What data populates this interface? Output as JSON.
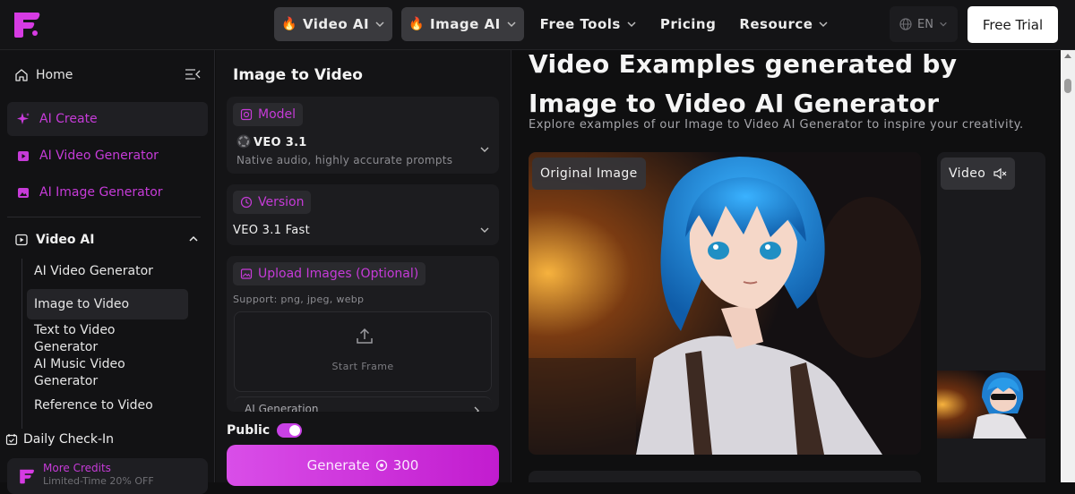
{
  "topbar": {
    "nav": [
      {
        "label": "Video AI",
        "fire": "🔥",
        "highlighted": true
      },
      {
        "label": "Image AI",
        "fire": "🔥",
        "highlighted": true
      },
      {
        "label": "Free Tools"
      },
      {
        "label": "Pricing"
      },
      {
        "label": "Resource"
      }
    ],
    "language": "EN",
    "trial_label": "Free Trial"
  },
  "sidebar": {
    "home": "Home",
    "items": [
      {
        "label": "AI Create",
        "icon": "sparkle-icon"
      },
      {
        "label": "AI Video Generator",
        "icon": "video-icon"
      },
      {
        "label": "AI Image Generator",
        "icon": "image-icon"
      }
    ],
    "group": "Video AI",
    "subitems": [
      "AI Video Generator",
      "Image to Video",
      "Text to Video Generator",
      "AI Music Video Generator",
      "Reference to Video"
    ],
    "checkin": "Daily Check-In",
    "promo": {
      "line1": "More Credits",
      "line2": "Limited-Time 20% OFF"
    }
  },
  "panel": {
    "title": "Image to Video",
    "model": {
      "chip": "Model",
      "value": "VEO 3.1",
      "note": "Native audio, highly accurate prompts"
    },
    "version": {
      "chip": "Version",
      "value": "VEO 3.1 Fast"
    },
    "upload": {
      "chip": "Upload Images (Optional)",
      "support": "Support: png, jpeg, webp",
      "start_frame": "Start Frame",
      "ai_generation": "AI Generation"
    },
    "public_label": "Public",
    "public_on": true,
    "generate_label": "Generate",
    "generate_cost": "300"
  },
  "main": {
    "heading": "Video Examples generated by Image to Video AI Generator",
    "description": "Explore examples of our Image to Video AI Generator to inspire your creativity.",
    "original_label": "Original Image",
    "video_label": "Video"
  },
  "colors": {
    "accent": "#c63bd8",
    "generate": "#d94ee8",
    "hair": "#1f7fd0"
  }
}
